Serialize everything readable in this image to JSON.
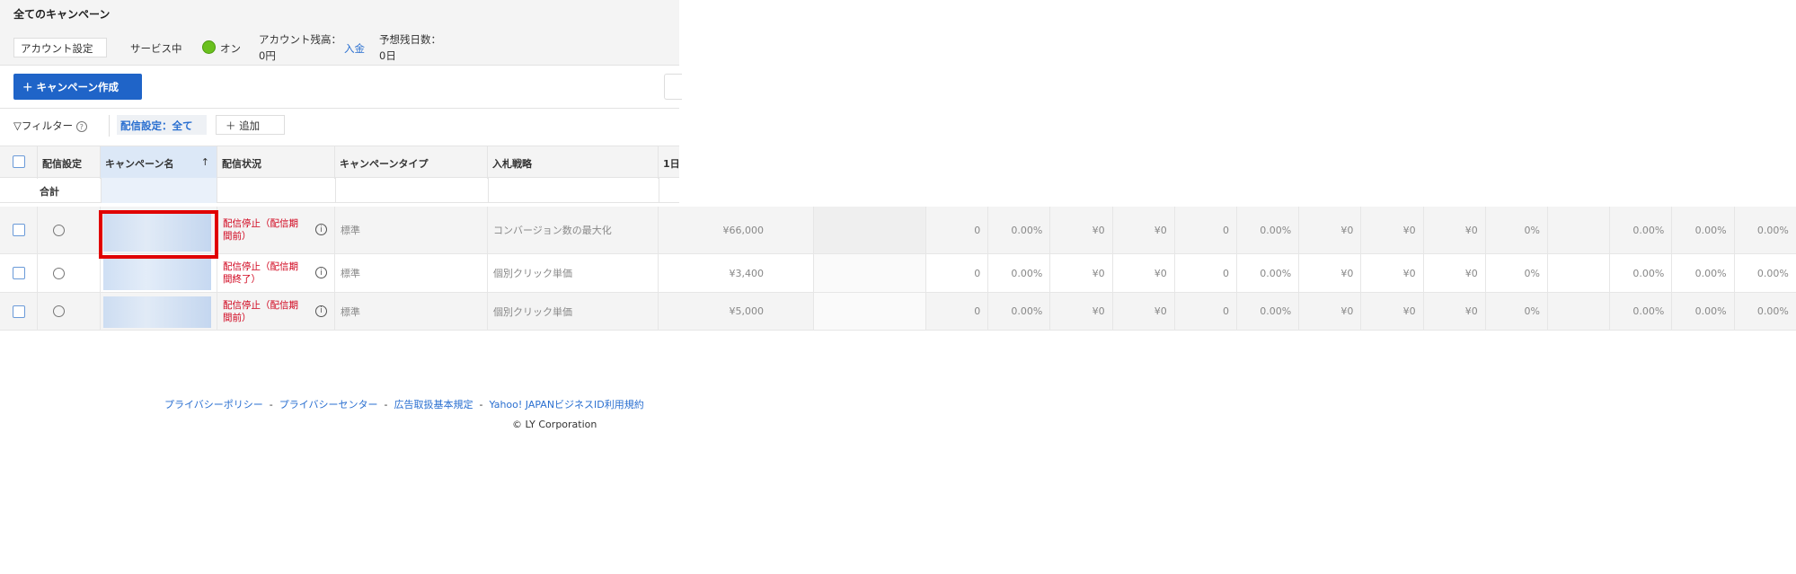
{
  "header": {
    "title": "全てのキャンペーン",
    "account_settings": "アカウント設定",
    "service_label": "サービス中",
    "service_status": "オン",
    "balance_label": "アカウント残高：",
    "balance_value": "0円",
    "deposit_link": "入金",
    "days_label": "予想残日数：",
    "days_value": "0日",
    "status_color": "#6ac01e"
  },
  "toolbar": {
    "create_label": "キャンペーン作成",
    "plus_icon": "＋"
  },
  "filter": {
    "label": "フィルター",
    "help_icon": "?",
    "chip": "配信設定：全て",
    "add_label": "追加"
  },
  "table": {
    "columns": [
      "配信設定",
      "キャンペーン名",
      "配信状況",
      "キャンペーンタイプ",
      "入札戦略",
      "1日"
    ],
    "sort_icon": "↑",
    "total_label": "合計",
    "rows": [
      {
        "status": "配信停止（配信期間前）",
        "type": "標準",
        "strategy": "コンバージョン数の最大化",
        "budget": "¥66,000",
        "metrics": [
          "0",
          "0.00%",
          "¥0",
          "¥0",
          "0",
          "0.00%",
          "¥0",
          "¥0",
          "¥0",
          "0%",
          "",
          "0.00%",
          "0.00%",
          "0.00%"
        ]
      },
      {
        "status": "配信停止（配信期間終了）",
        "type": "標準",
        "strategy": "個別クリック単価",
        "budget": "¥3,400",
        "metrics": [
          "0",
          "0.00%",
          "¥0",
          "¥0",
          "0",
          "0.00%",
          "¥0",
          "¥0",
          "¥0",
          "0%",
          "",
          "0.00%",
          "0.00%",
          "0.00%"
        ]
      },
      {
        "status": "配信停止（配信期間前）",
        "type": "標準",
        "strategy": "個別クリック単価",
        "budget": "¥5,000",
        "metrics": [
          "0",
          "0.00%",
          "¥0",
          "¥0",
          "0",
          "0.00%",
          "¥0",
          "¥0",
          "¥0",
          "0%",
          "",
          "0.00%",
          "0.00%",
          "0.00%"
        ]
      }
    ]
  },
  "footer": {
    "links": [
      "プライバシーポリシー",
      "プライバシーセンター",
      "広告取扱基本規定",
      "Yahoo! JAPANビジネスID利用規約"
    ],
    "separator": "-",
    "copyright": "© LY Corporation"
  },
  "highlight_color": "#e00000"
}
